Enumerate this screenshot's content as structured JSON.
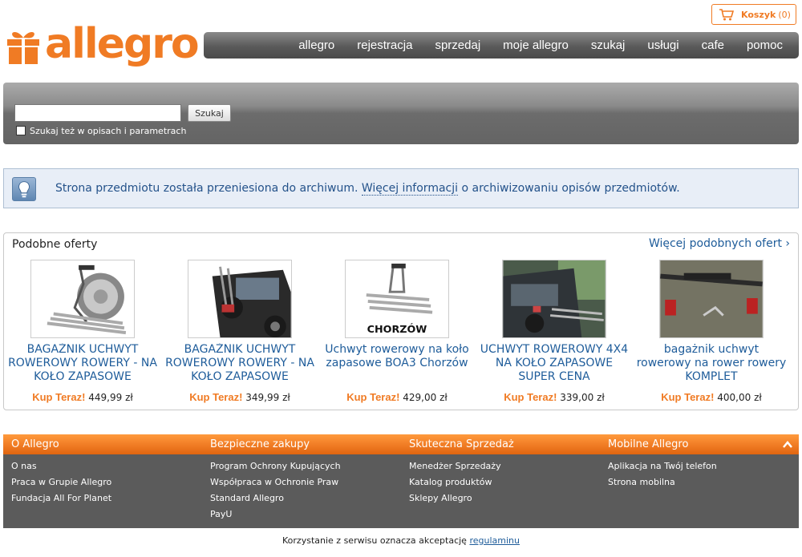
{
  "cart": {
    "label": "Koszyk",
    "count": "(0)",
    "icon": "cart-icon"
  },
  "logo": {
    "text": "allegro",
    "icon": "gift-icon",
    "color": "#f07b24"
  },
  "nav": [
    "allegro",
    "rejestracja",
    "sprzedaj",
    "moje allegro",
    "szukaj",
    "usługi",
    "cafe",
    "pomoc"
  ],
  "search": {
    "value": "",
    "button": "Szukaj",
    "checkbox_label": "Szukaj też w opisach i parametrach",
    "checked": false
  },
  "info": {
    "icon": "lightbulb-icon",
    "text_before": "Strona przedmiotu została przeniesiona do archiwum.",
    "link": "Więcej informacji",
    "text_after": "o archiwizowaniu opisów przedmiotów."
  },
  "offers": {
    "title": "Podobne oferty",
    "more": "Więcej podobnych ofert ›",
    "buy_label": "Kup Teraz!",
    "items": [
      {
        "title": "BAGAŻNIK UCHWYT ROWEROWY ROWERY - NA KOŁO ZAPASOWE",
        "price": "449,99 zł"
      },
      {
        "title": "BAGAŻNIK UCHWYT ROWEROWY ROWERY - NA KOŁO ZAPASOWE",
        "price": "349,99 zł"
      },
      {
        "title": "Uchwyt rowerowy na koło zapasowe BOA3 Chorzów",
        "price": "429,00 zł",
        "image_text": "CHORZÓW"
      },
      {
        "title": "UCHWYT ROWEROWY 4X4 NA KOŁO ZAPASOWE SUPER CENA",
        "price": "339,00 zł"
      },
      {
        "title": "bagażnik uchwyt rowerowy na rower rowery KOMPLET",
        "price": "400,00 zł"
      }
    ]
  },
  "footer": {
    "accent": "#f07b24",
    "columns": [
      {
        "title": "O Allegro",
        "links": [
          "O nas",
          "Praca w Grupie Allegro",
          "Fundacja All For Planet"
        ]
      },
      {
        "title": "Bezpieczne zakupy",
        "links": [
          "Program Ochrony Kupujących",
          "Współpraca w Ochronie Praw",
          "Standard Allegro",
          "PayU"
        ]
      },
      {
        "title": "Skuteczna Sprzedaż",
        "links": [
          "Menedżer Sprzedaży",
          "Katalog produktów",
          "Sklepy Allegro"
        ]
      },
      {
        "title": "Mobilne Allegro",
        "links": [
          "Aplikacja na Twój telefon",
          "Strona mobilna"
        ]
      }
    ]
  },
  "terms": {
    "text": "Korzystanie z serwisu oznacza akceptację",
    "link": "regulaminu"
  }
}
